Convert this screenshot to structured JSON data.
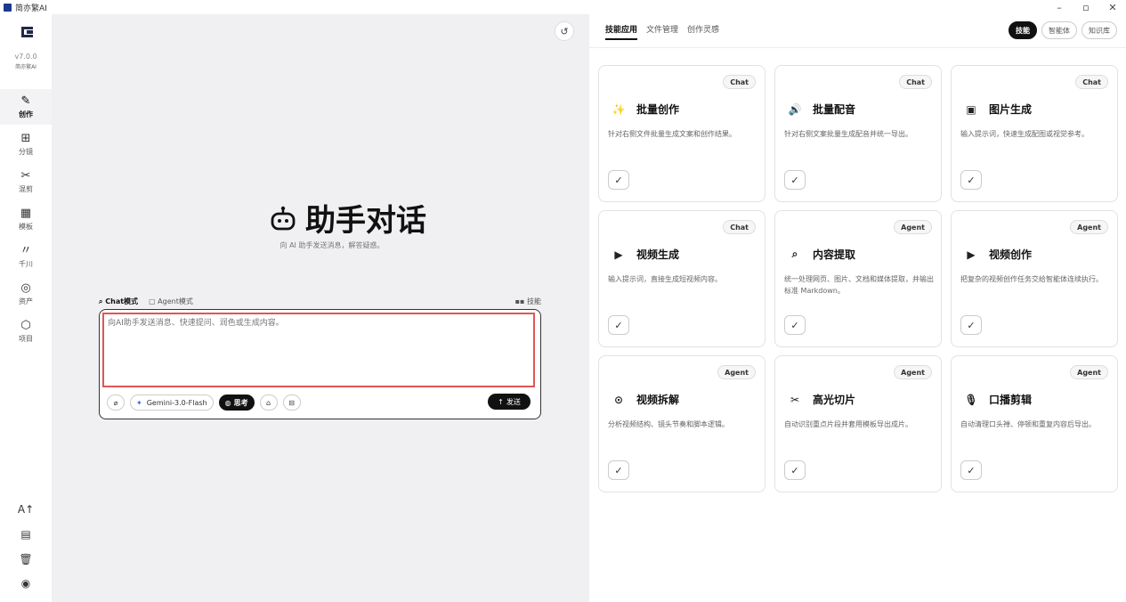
{
  "window": {
    "title": "简亦繁AI",
    "minimize": "–",
    "maximize": "▫",
    "close": "✕"
  },
  "sidebar": {
    "version": "v7.0.0",
    "app_name": "简亦繁AI",
    "items": [
      {
        "label": "创作",
        "icon": "✎"
      },
      {
        "label": "分镜",
        "icon": "⊞"
      },
      {
        "label": "混剪",
        "icon": "✂"
      },
      {
        "label": "模板",
        "icon": "▦"
      },
      {
        "label": "千川",
        "icon": "〃"
      },
      {
        "label": "资产",
        "icon": "◎"
      },
      {
        "label": "项目",
        "icon": "⬡"
      }
    ],
    "bottom_icons": [
      "A↑",
      "▤",
      "🗑",
      "◉"
    ]
  },
  "center": {
    "history_icon": "↺",
    "title": "助手对话",
    "subtitle": "向 AI 助手发送消息，解答疑惑。",
    "mode_chat": "Chat模式",
    "mode_agent": "Agent模式",
    "skills_label": "技能",
    "input_placeholder": "向AI助手发送消息、快速提问、润色或生成内容。",
    "model": "Gemini-3.0-Flash",
    "think_label": "思考",
    "send_label": "发送"
  },
  "right": {
    "tabs": [
      "技能应用",
      "文件管理",
      "创作灵感"
    ],
    "top_buttons": [
      "技能",
      "智能体",
      "知识库"
    ],
    "check_mark": "✓",
    "cards": [
      {
        "tag": "Chat",
        "icon": "✨",
        "title": "批量创作",
        "desc": "针对右侧文件批量生成文案和创作结果。"
      },
      {
        "tag": "Chat",
        "icon": "🔊",
        "title": "批量配音",
        "desc": "针对右侧文案批量生成配音并统一导出。"
      },
      {
        "tag": "Chat",
        "icon": "▣",
        "title": "图片生成",
        "desc": "输入提示词，快速生成配图或视觉参考。"
      },
      {
        "tag": "Chat",
        "icon": "▶",
        "title": "视频生成",
        "desc": "输入提示词，直接生成短视频内容。"
      },
      {
        "tag": "Agent",
        "icon": "⌕",
        "title": "内容提取",
        "desc": "统一处理网页、图片、文档和媒体提取，并输出标准 Markdown。"
      },
      {
        "tag": "Agent",
        "icon": "▶",
        "title": "视频创作",
        "desc": "把复杂的视频创作任务交给智能体连续执行。"
      },
      {
        "tag": "Agent",
        "icon": "⊙",
        "title": "视频拆解",
        "desc": "分析视频结构、镜头节奏和脚本逻辑。"
      },
      {
        "tag": "Agent",
        "icon": "✂",
        "title": "高光切片",
        "desc": "自动识别重点片段并套用模板导出成片。"
      },
      {
        "tag": "Agent",
        "icon": "🎙",
        "title": "口播剪辑",
        "desc": "自动清理口头禅、停顿和重复内容后导出。"
      }
    ]
  }
}
